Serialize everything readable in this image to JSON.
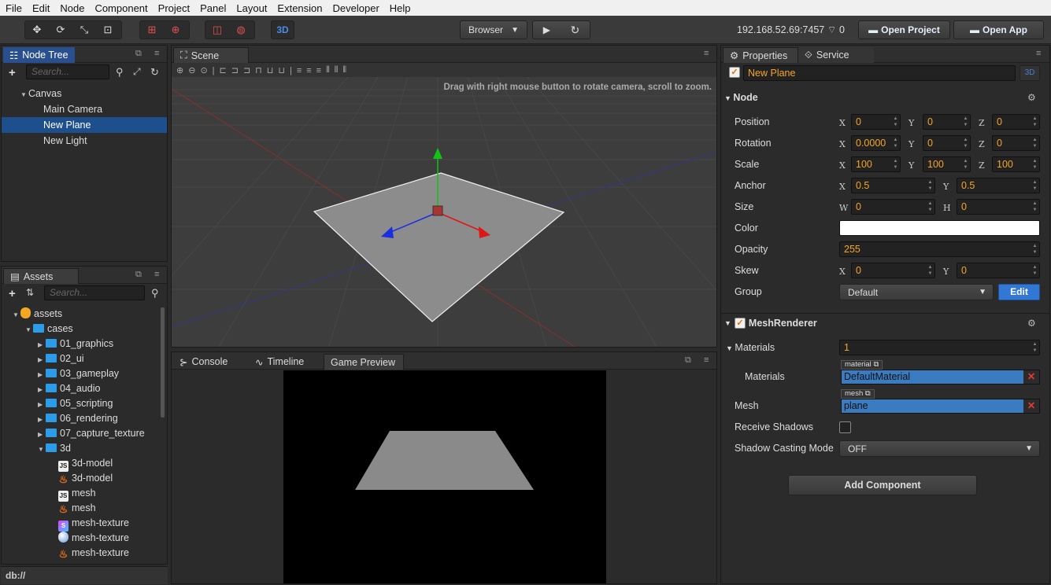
{
  "menu": [
    "File",
    "Edit",
    "Node",
    "Component",
    "Project",
    "Panel",
    "Layout",
    "Extension",
    "Developer",
    "Help"
  ],
  "toolbar": {
    "mode3d": "3D",
    "platform": "Browser",
    "ip": "192.168.52.69:7457",
    "conn_count": "0",
    "open_project": "Open Project",
    "open_app": "Open App"
  },
  "node_tree": {
    "tab": "Node Tree",
    "search": "Search...",
    "items": [
      "Canvas",
      "Main Camera",
      "New Plane",
      "New Light"
    ]
  },
  "assets": {
    "tab": "Assets",
    "search": "Search...",
    "root": "assets",
    "cases": "cases",
    "folders": [
      "01_graphics",
      "02_ui",
      "03_gameplay",
      "04_audio",
      "05_scripting",
      "06_rendering",
      "07_capture_texture",
      "3d"
    ],
    "files": [
      "3d-model",
      "3d-model",
      "mesh",
      "mesh",
      "mesh-texture",
      "mesh-texture",
      "mesh-texture"
    ],
    "footer": "db://"
  },
  "scene": {
    "tab": "Scene",
    "hint": "Drag with right mouse button to rotate camera, scroll to zoom."
  },
  "bottom_tabs": [
    "Console",
    "Timeline",
    "Game Preview"
  ],
  "props": {
    "tab": "Properties",
    "tab2": "Service",
    "node_name": "New Plane",
    "badge": "3D",
    "node_section": "Node",
    "position": {
      "label": "Position",
      "x": "0",
      "y": "0",
      "z": "0"
    },
    "rotation": {
      "label": "Rotation",
      "x": "0.0000",
      "y": "0",
      "z": "0"
    },
    "scale": {
      "label": "Scale",
      "x": "100",
      "y": "100",
      "z": "100"
    },
    "anchor": {
      "label": "Anchor",
      "x": "0.5",
      "y": "0.5"
    },
    "size": {
      "label": "Size",
      "w": "0",
      "h": "0"
    },
    "color": {
      "label": "Color"
    },
    "opacity": {
      "label": "Opacity",
      "value": "255"
    },
    "skew": {
      "label": "Skew",
      "x": "0",
      "y": "0"
    },
    "group": {
      "label": "Group",
      "value": "Default",
      "edit": "Edit"
    },
    "mesh_renderer": "MeshRenderer",
    "materials_count": {
      "label": "Materials",
      "value": "1"
    },
    "materials": {
      "label": "Materials",
      "tag": "material",
      "value": "DefaultMaterial"
    },
    "mesh": {
      "label": "Mesh",
      "tag": "mesh",
      "value": "plane"
    },
    "receive_shadows": "Receive Shadows",
    "shadow_mode": {
      "label": "Shadow Casting Mode",
      "value": "OFF"
    },
    "add_component": "Add Component"
  },
  "axis_letters": {
    "x": "X",
    "y": "Y",
    "z": "Z",
    "w": "W",
    "h": "H"
  },
  "colors": {
    "accent": "#1d4f8d",
    "field_text": "#f5a623",
    "edit_button": "#3277d3"
  }
}
